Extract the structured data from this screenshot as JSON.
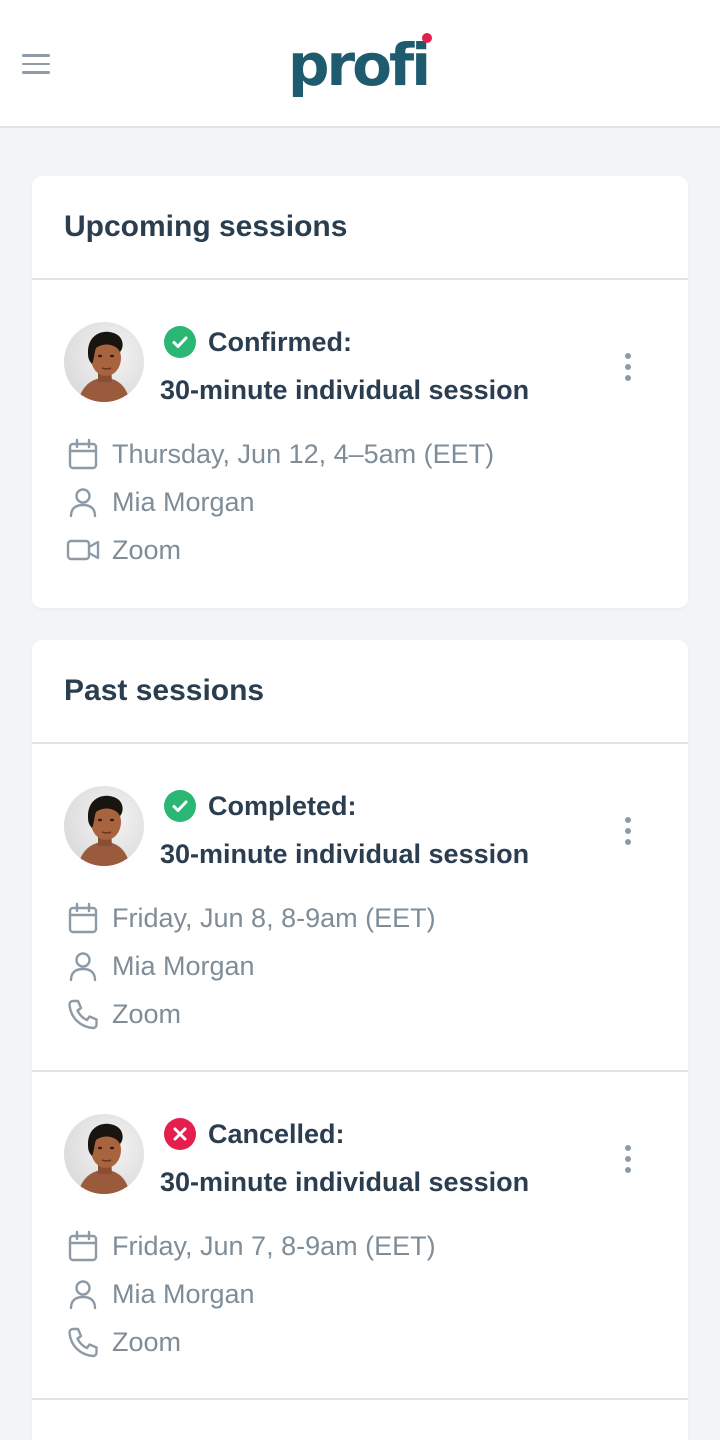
{
  "header": {
    "logo_text": "profi",
    "menu_icon": "hamburger-menu-icon",
    "colors": {
      "logo": "#1e5b6e",
      "logo_dot": "#e41f4e"
    }
  },
  "upcoming": {
    "title": "Upcoming sessions",
    "sessions": [
      {
        "status": "Confirmed:",
        "status_type": "success",
        "title": "30-minute individual session",
        "datetime": "Thursday, Jun 12, 4–5am (EET)",
        "person": "Mia Morgan",
        "location": "Zoom",
        "location_icon": "video-camera-icon"
      }
    ]
  },
  "past": {
    "title": "Past sessions",
    "sessions": [
      {
        "status": "Completed:",
        "status_type": "success",
        "title": "30-minute individual session",
        "datetime": "Friday, Jun 8, 8-9am (EET)",
        "person": "Mia Morgan",
        "location": "Zoom",
        "location_icon": "phone-icon"
      },
      {
        "status": "Cancelled:",
        "status_type": "error",
        "title": "30-minute individual session",
        "datetime": "Friday, Jun 7, 8-9am (EET)",
        "person": "Mia Morgan",
        "location": "Zoom",
        "location_icon": "phone-icon"
      }
    ]
  },
  "colors": {
    "success": "#2bb673",
    "error": "#e41f4e",
    "text": "#2b3e4f",
    "muted": "#7f8d99",
    "background": "#f2f5f7"
  }
}
